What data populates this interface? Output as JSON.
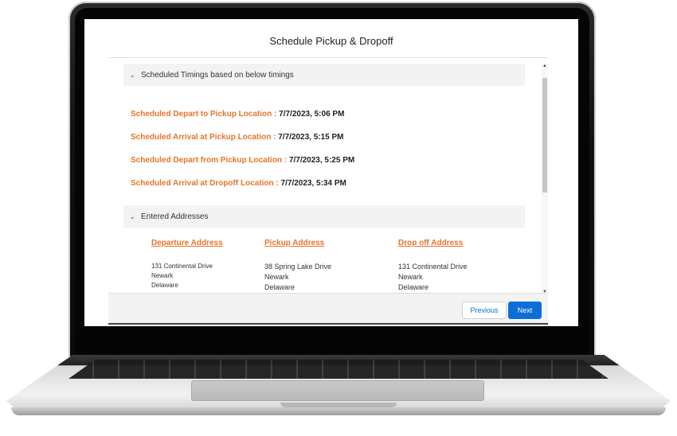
{
  "modal": {
    "title": "Schedule Pickup & Dropoff"
  },
  "timings_section": {
    "header": "Scheduled Timings based on below timings",
    "rows": [
      {
        "label": "Scheduled Depart to Pickup Location :",
        "value": "7/7/2023, 5:06 PM"
      },
      {
        "label": "Scheduled Arrival at Pickup Location :",
        "value": "7/7/2023, 5:15 PM"
      },
      {
        "label": "Scheduled Depart from Pickup Location :",
        "value": "7/7/2023, 5:25 PM"
      },
      {
        "label": "Scheduled Arrival at Dropoff Location :",
        "value": "7/7/2023, 5:34 PM"
      }
    ]
  },
  "addresses_section": {
    "header": "Entered Addresses",
    "columns": [
      {
        "heading": "Departure Address",
        "lines": [
          "131 Continental Drive",
          "Newark",
          "Delaware"
        ]
      },
      {
        "heading": "Pickup Address",
        "lines": [
          "38 Spring Lake Drive",
          "Newark",
          "Delaware"
        ]
      },
      {
        "heading": "Drop off Address",
        "lines": [
          "131 Continental Drive",
          "Newark",
          "Delaware"
        ]
      }
    ]
  },
  "footer": {
    "previous_label": "Previous",
    "next_label": "Next"
  },
  "icons": {
    "section_toggle": "chevron-down-icon",
    "scroll_up": "scroll-up-arrow-icon",
    "scroll_down": "scroll-down-arrow-icon"
  },
  "colors": {
    "accent_orange": "#e7742b",
    "brand_blue": "#0b6fd6",
    "section_bg": "#f3f3f3"
  }
}
